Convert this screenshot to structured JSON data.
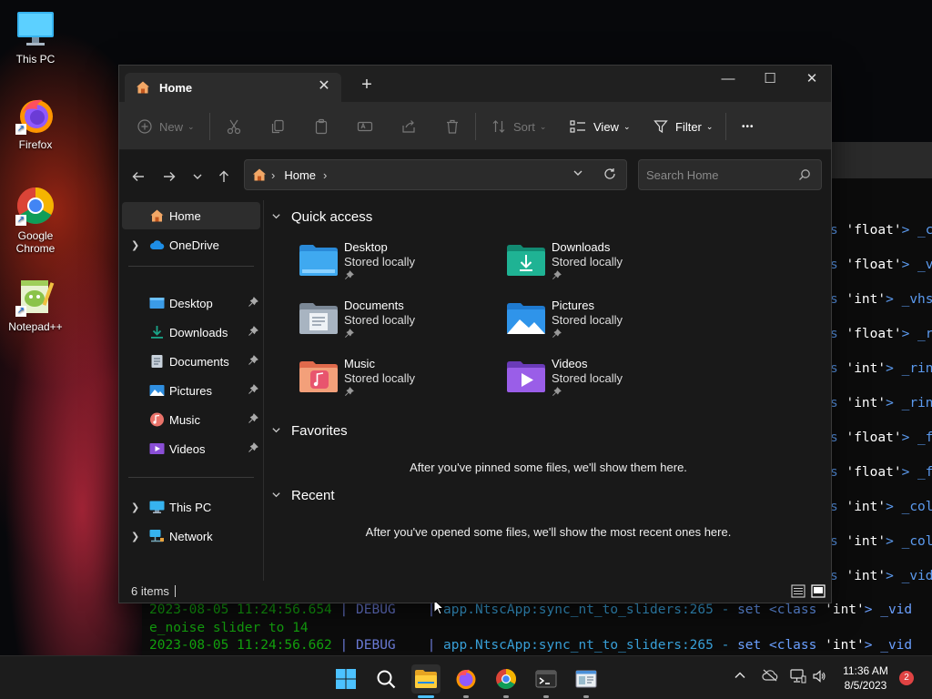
{
  "desktop": {
    "icons": [
      {
        "label": "This PC",
        "icon": "monitor-icon"
      },
      {
        "label": "Firefox",
        "icon": "firefox-icon"
      },
      {
        "label": "Google Chrome",
        "icon": "chrome-icon"
      },
      {
        "label": "Notepad++",
        "icon": "notepadpp-icon"
      }
    ]
  },
  "terminal": {
    "right_lines": [
      {
        "prefix": "s ",
        "str": "'float'",
        "rest": "> _c"
      },
      {
        "prefix": "s ",
        "str": "'float'",
        "rest": "> _v"
      },
      {
        "prefix": "s ",
        "str": "'int'",
        "rest": "> _vhs"
      },
      {
        "prefix": "s ",
        "str": "'float'",
        "rest": "> _r"
      },
      {
        "prefix": "s ",
        "str": "'int'",
        "rest": "> _rin"
      },
      {
        "prefix": "s ",
        "str": "'int'",
        "rest": "> _rin"
      },
      {
        "prefix": "s ",
        "str": "'float'",
        "rest": "> _f"
      },
      {
        "prefix": "s ",
        "str": "'float'",
        "rest": "> _f"
      },
      {
        "prefix": "s ",
        "str": "'int'",
        "rest": "> _col"
      },
      {
        "prefix": "s ",
        "str": "'int'",
        "rest": "> _col"
      },
      {
        "prefix": "s ",
        "str": "'int'",
        "rest": "> _vid"
      }
    ],
    "log1": {
      "time": "2023-08-05 11:24:56.654",
      "level": "DEBUG",
      "sep": "|",
      "source": "app.NtscApp:sync_nt_to_sliders:265",
      "dash": "-",
      "set": "set <class",
      "str": "'int'",
      "rest": "> _vid"
    },
    "log1_wrap": "e_noise slider to 14",
    "log2": {
      "time": "2023-08-05 11:24:56.662",
      "level": "DEBUG",
      "sep": "|",
      "source": "app.NtscApp:sync_nt_to_sliders:265",
      "dash": "-",
      "set": "set <class",
      "str": "'int'",
      "rest": "> _vid"
    }
  },
  "explorer": {
    "tab": {
      "title": "Home",
      "close": "✕"
    },
    "new_tab": "+",
    "window_controls": {
      "minimize": "—",
      "maximize": "☐",
      "close": "✕"
    },
    "toolbar": {
      "new_label": "New",
      "sort_label": "Sort",
      "view_label": "View",
      "filter_label": "Filter",
      "more_label": "•••"
    },
    "address": {
      "root_sep": "›",
      "crumb": "Home",
      "crumb_sep": "›"
    },
    "search": {
      "placeholder": "Search Home"
    },
    "sidebar": {
      "home": "Home",
      "onedrive": "OneDrive",
      "pinned": [
        {
          "label": "Desktop",
          "icon": "desktop-folder-icon"
        },
        {
          "label": "Downloads",
          "icon": "downloads-folder-icon"
        },
        {
          "label": "Documents",
          "icon": "documents-folder-icon"
        },
        {
          "label": "Pictures",
          "icon": "pictures-folder-icon"
        },
        {
          "label": "Music",
          "icon": "music-folder-icon"
        },
        {
          "label": "Videos",
          "icon": "videos-folder-icon"
        }
      ],
      "this_pc": "This PC",
      "network": "Network"
    },
    "content": {
      "quick_access": "Quick access",
      "folders": [
        {
          "name": "Desktop",
          "status": "Stored locally"
        },
        {
          "name": "Downloads",
          "status": "Stored locally"
        },
        {
          "name": "Documents",
          "status": "Stored locally"
        },
        {
          "name": "Pictures",
          "status": "Stored locally"
        },
        {
          "name": "Music",
          "status": "Stored locally"
        },
        {
          "name": "Videos",
          "status": "Stored locally"
        }
      ],
      "favorites": "Favorites",
      "favorites_empty": "After you've pinned some files, we'll show them here.",
      "recent": "Recent",
      "recent_empty": "After you've opened some files, we'll show the most recent ones here."
    },
    "status": {
      "count": "6 items"
    }
  },
  "taskbar": {
    "time": "11:36 AM",
    "date": "8/5/2023",
    "notifications": "2"
  },
  "colors": {
    "accent": "#4cc2ff",
    "folder_blue": "#3b9be6",
    "folder_teal": "#1aa589",
    "terminal_green": "#13a10e"
  }
}
